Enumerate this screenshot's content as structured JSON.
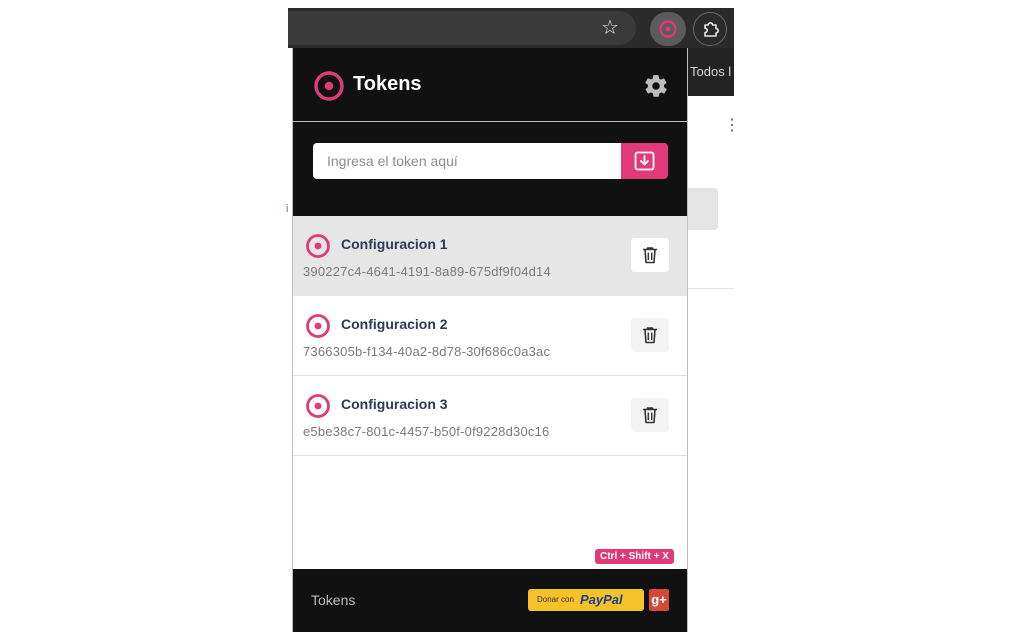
{
  "browser": {
    "bookmark_label": "Todos l",
    "star_glyph": "☆",
    "kebab_glyph": "⋮",
    "left_mark": "i"
  },
  "header": {
    "title": "Tokens",
    "logo_icon": "target-icon",
    "settings_icon": "gear-icon"
  },
  "token_input": {
    "placeholder": "Ingresa el token aquí",
    "value": "",
    "import_icon": "import-icon"
  },
  "tokens": [
    {
      "name": "Configuracion 1",
      "id": "390227c4-4641-4191-8a89-675df9f04d14",
      "active": true
    },
    {
      "name": "Configuracion 2",
      "id": "7366305b-f134-40a2-8d78-30f686c0a3ac",
      "active": false
    },
    {
      "name": "Configuracion 3",
      "id": "e5be38c7-801c-4457-b50f-0f9228d30c16",
      "active": false
    }
  ],
  "shortcut": "Ctrl + Shift + X",
  "footer": {
    "label": "Tokens",
    "paypal_prefix": "Donar con",
    "paypal_brand": "PayPal",
    "gplus_label": "g+"
  },
  "colors": {
    "accent": "#e23a78",
    "header_bg": "#111111",
    "paypal_yellow": "#f5c22a",
    "paypal_blue": "#1b3f8b",
    "gplus_red": "#d34836"
  }
}
